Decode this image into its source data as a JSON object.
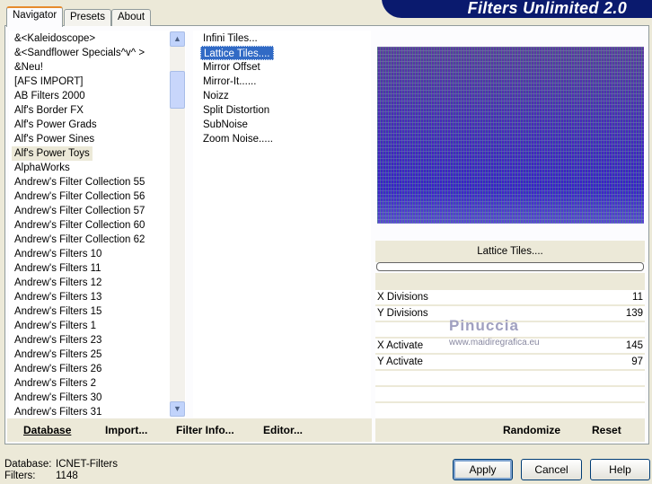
{
  "app": {
    "title": "Filters Unlimited 2.0"
  },
  "tabs": [
    {
      "label": "Navigator"
    },
    {
      "label": "Presets"
    },
    {
      "label": "About"
    }
  ],
  "categories": {
    "selected": "Alf's Power Toys",
    "items": [
      "&<Kaleidoscope>",
      "&<Sandflower Specials^v^ >",
      "&Neu!",
      "[AFS IMPORT]",
      "AB Filters 2000",
      "Alf's Border FX",
      "Alf's Power Grads",
      "Alf's Power Sines",
      "Alf's Power Toys",
      "AlphaWorks",
      "Andrew's Filter Collection 55",
      "Andrew's Filter Collection 56",
      "Andrew's Filter Collection 57",
      "Andrew's Filter Collection 60",
      "Andrew's Filter Collection 62",
      "Andrew's Filters 10",
      "Andrew's Filters 11",
      "Andrew's Filters 12",
      "Andrew's Filters 13",
      "Andrew's Filters 15",
      "Andrew's Filters 1",
      "Andrew's Filters 23",
      "Andrew's Filters 25",
      "Andrew's Filters 26",
      "Andrew's Filters 2",
      "Andrew's Filters 30",
      "Andrew's Filters 31"
    ]
  },
  "filters": {
    "selected": "Lattice Tiles....",
    "items": [
      "Infini Tiles...",
      "Lattice Tiles....",
      "Mirror Offset",
      "Mirror-It......",
      "Noizz",
      "Split Distortion",
      "SubNoise",
      "Zoom Noise....."
    ]
  },
  "preview": {
    "filter_name": "Lattice Tiles...."
  },
  "params": [
    {
      "label": "X Divisions",
      "value": "11"
    },
    {
      "label": "Y Divisions",
      "value": "139"
    },
    {
      "label": "",
      "value": ""
    },
    {
      "label": "X Activate",
      "value": "145"
    },
    {
      "label": "Y Activate",
      "value": "97"
    },
    {
      "label": "",
      "value": ""
    },
    {
      "label": "",
      "value": ""
    },
    {
      "label": "",
      "value": ""
    }
  ],
  "watermark": {
    "name": "Pinuccia",
    "url": "www.maidiregrafica.eu"
  },
  "left_buttons": {
    "database": "Database",
    "import": "Import...",
    "filter_info": "Filter Info...",
    "editor": "Editor..."
  },
  "right_buttons": {
    "randomize": "Randomize",
    "reset": "Reset"
  },
  "status": {
    "database_label": "Database:",
    "database_value": "ICNET-Filters",
    "filters_label": "Filters:",
    "filters_value": "1148"
  },
  "dialog_buttons": {
    "apply": "Apply",
    "cancel": "Cancel",
    "help": "Help"
  }
}
